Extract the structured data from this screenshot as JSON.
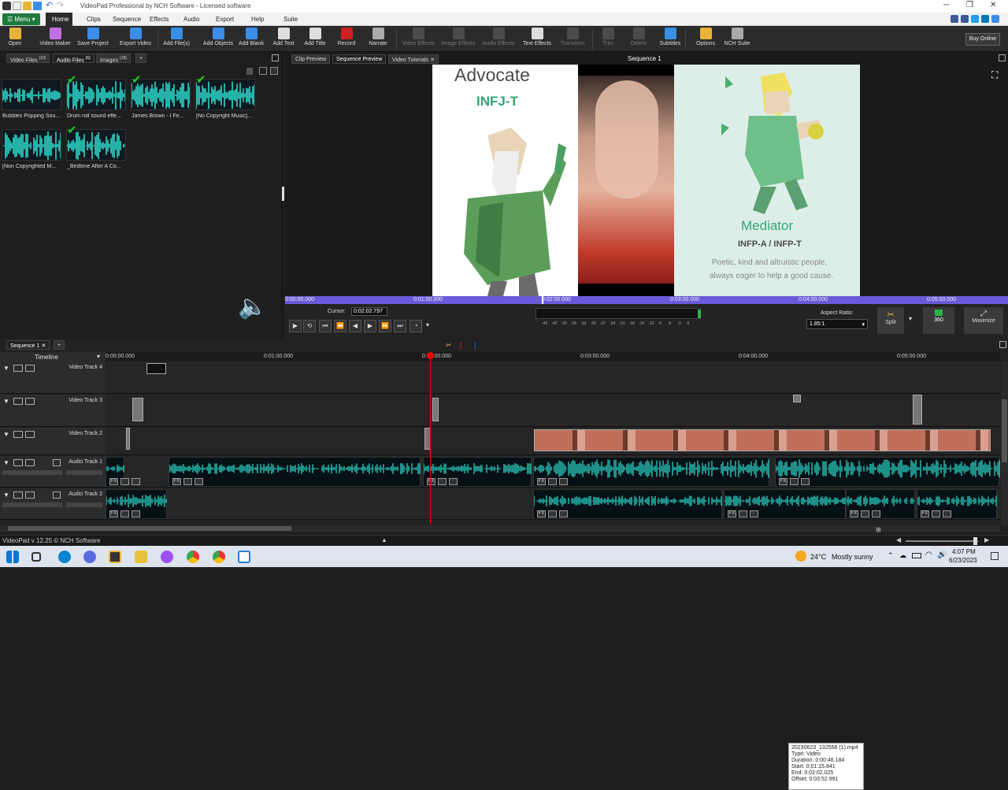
{
  "window": {
    "title": "VideoPad Professional by NCH Software - Licensed software",
    "minimize": "─",
    "maximize": "❐",
    "close": "✕"
  },
  "menubar": {
    "menu_label": "Menu",
    "items": [
      "Home",
      "Clips",
      "Sequence",
      "Effects",
      "Audio",
      "Export",
      "Help",
      "Suite"
    ]
  },
  "toolbar": {
    "buttons": [
      {
        "label": "Open",
        "icon": "folder-icon",
        "color": "#e8b33a",
        "enabled": true
      },
      {
        "label": "Video Maker",
        "icon": "wand-icon",
        "color": "#c070e0",
        "enabled": true
      },
      {
        "label": "Save Project",
        "icon": "save-icon",
        "color": "#3a8ee8",
        "enabled": true
      },
      {
        "label": "Export Video",
        "icon": "export-icon",
        "color": "#3a8ee8",
        "enabled": true
      },
      {
        "label": "Add File(s)",
        "icon": "add-file-icon",
        "color": "#3a8ee8",
        "enabled": true
      },
      {
        "label": "Add Objects",
        "icon": "add-objects-icon",
        "color": "#3a8ee8",
        "enabled": true
      },
      {
        "label": "Add Blank",
        "icon": "add-blank-icon",
        "color": "#3a8ee8",
        "enabled": true
      },
      {
        "label": "Add Text",
        "icon": "text-icon",
        "color": "#dddddd",
        "enabled": true
      },
      {
        "label": "Add Title",
        "icon": "title-icon",
        "color": "#dddddd",
        "enabled": true
      },
      {
        "label": "Record",
        "icon": "record-icon",
        "color": "#cc2222",
        "enabled": true
      },
      {
        "label": "Narrate",
        "icon": "mic-icon",
        "color": "#aaaaaa",
        "enabled": true
      },
      {
        "label": "Video Effects",
        "icon": "video-effects-icon",
        "color": "#888888",
        "enabled": false
      },
      {
        "label": "Image Effects",
        "icon": "image-effects-icon",
        "color": "#888888",
        "enabled": false
      },
      {
        "label": "Audio Effects",
        "icon": "audio-effects-icon",
        "color": "#888888",
        "enabled": false
      },
      {
        "label": "Text Effects",
        "icon": "text-effects-icon",
        "color": "#dddddd",
        "enabled": true
      },
      {
        "label": "Transition",
        "icon": "transition-icon",
        "color": "#888888",
        "enabled": false
      },
      {
        "label": "Trim",
        "icon": "trim-icon",
        "color": "#888888",
        "enabled": false
      },
      {
        "label": "Delete",
        "icon": "delete-icon",
        "color": "#888888",
        "enabled": false
      },
      {
        "label": "Subtitles",
        "icon": "subtitles-icon",
        "color": "#3a8ee8",
        "enabled": true
      },
      {
        "label": "Options",
        "icon": "options-icon",
        "color": "#e8b33a",
        "enabled": true
      },
      {
        "label": "NCH Suite",
        "icon": "suite-icon",
        "color": "#aaaaaa",
        "enabled": true
      }
    ],
    "buy_online": "Buy Online"
  },
  "media_bin": {
    "tabs": [
      {
        "label": "Video Files",
        "count": "(10)"
      },
      {
        "label": "Audio Files",
        "count": "(6)"
      },
      {
        "label": "Images",
        "count": "(18)"
      }
    ],
    "add_tab": "+",
    "files": [
      {
        "name": "Bubbles Popping Sou...",
        "checked": false
      },
      {
        "name": "Drum roll sound effe...",
        "checked": true
      },
      {
        "name": "James Brown - I Fe...",
        "checked": true
      },
      {
        "name": "[No Copyright Music]...",
        "checked": true
      },
      {
        "name": "[Non Copyrighted M...",
        "checked": false
      },
      {
        "name": "_Bedtime After A Co...",
        "checked": true
      }
    ]
  },
  "preview": {
    "tabs": [
      "Clip Preview",
      "Sequence Preview",
      "Video Tutorials"
    ],
    "active_tab": "Sequence Preview",
    "title": "Sequence 1",
    "left_panel": {
      "title": "Advocate",
      "subtitle": "INFJ-T"
    },
    "right_panel": {
      "title": "Mediator",
      "subtitle": "INFP-A / INFP-T",
      "description_1": "Poetic, kind and altruistic people,",
      "description_2": "always eager to help a good cause."
    },
    "ruler_ticks": [
      "0:00:00.000",
      "0:01:00.000",
      "0:02:00.000",
      "0:03:00.000",
      "0:04:00.000",
      "0:05:00.000"
    ],
    "cursor_label": "Cursor:",
    "cursor_value": "0:02:02.797",
    "meter_ticks": [
      "-45",
      "-42",
      "-39",
      "-36",
      "-33",
      "-30",
      "-27",
      "-24",
      "-21",
      "-18",
      "-15",
      "-12",
      "-9",
      "-6",
      "-3",
      "0"
    ],
    "aspect_label": "Aspect Ratio:",
    "aspect_value": "1.85:1",
    "split_label": "Split",
    "three60_label": "360",
    "maximize_label": "Maximize"
  },
  "timeline": {
    "sequence_tab": "Sequence 1",
    "header_label": "Timeline",
    "ruler_ticks": [
      "0:00:00.000",
      "0:01:00.000",
      "0:02:00.000",
      "0:03:00.000",
      "0:04:00.000",
      "0:05:00.000"
    ],
    "playhead_time_sec": 122.797,
    "tracks": [
      {
        "name": "Video Track 4",
        "type": "video"
      },
      {
        "name": "Video Track 3",
        "type": "video"
      },
      {
        "name": "Video Track 2",
        "type": "video"
      },
      {
        "name": "Audio Track 1",
        "type": "audio"
      },
      {
        "name": "Audio Track 2",
        "type": "audio"
      }
    ],
    "tooltip": {
      "file": "20230623_132558 (1).mp4",
      "type": "Type: Video",
      "duration": "Duration: 0:00:46.184",
      "start": "Start: 0:01:15.841",
      "end": "End: 0:02:02.025",
      "offset": "Offset: 0:03:52.991"
    },
    "fx_label": "FX"
  },
  "statusbar": {
    "version": "VideoPad v 12.25 © NCH Software"
  },
  "taskbar": {
    "weather_temp": "24°C",
    "weather_desc": "Mostly sunny",
    "time": "4:07 PM",
    "date": "6/23/2023"
  },
  "colors": {
    "accent": "#6b5ad9",
    "playhead": "#ff0000",
    "waveform": "#2ee6d6",
    "menu_green": "#1f7a3d"
  }
}
